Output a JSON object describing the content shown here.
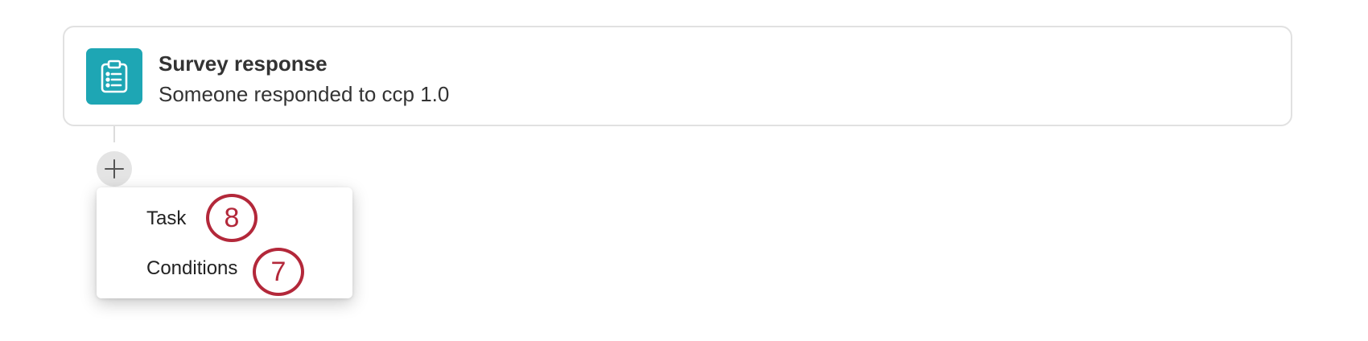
{
  "trigger": {
    "title": "Survey response",
    "subtitle": "Someone responded to ccp 1.0",
    "icon": "clipboard-list-icon",
    "icon_color": "#1ea6b4"
  },
  "add_button": {
    "icon": "plus-icon"
  },
  "add_menu": {
    "items": [
      {
        "label": "Task"
      },
      {
        "label": "Conditions"
      }
    ]
  },
  "callouts": [
    {
      "number": "8",
      "color": "#b3283a"
    },
    {
      "number": "7",
      "color": "#b3283a"
    }
  ]
}
